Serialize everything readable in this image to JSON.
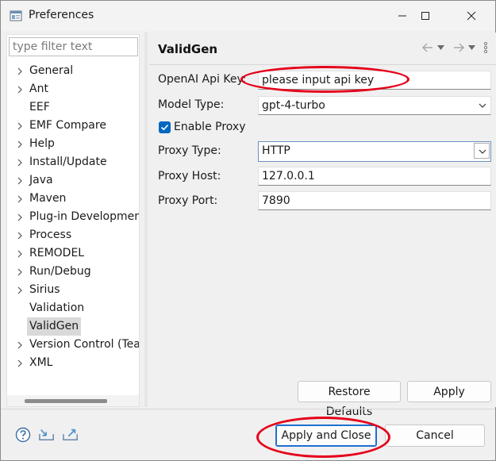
{
  "window": {
    "title": "Preferences"
  },
  "sidebar": {
    "filter_placeholder": "type filter text",
    "items": [
      {
        "label": "General",
        "expandable": true
      },
      {
        "label": "Ant",
        "expandable": true
      },
      {
        "label": "EEF",
        "expandable": false
      },
      {
        "label": "EMF Compare",
        "expandable": true
      },
      {
        "label": "Help",
        "expandable": true
      },
      {
        "label": "Install/Update",
        "expandable": true
      },
      {
        "label": "Java",
        "expandable": true
      },
      {
        "label": "Maven",
        "expandable": true
      },
      {
        "label": "Plug-in Development",
        "expandable": true
      },
      {
        "label": "Process",
        "expandable": true
      },
      {
        "label": "REMODEL",
        "expandable": true
      },
      {
        "label": "Run/Debug",
        "expandable": true
      },
      {
        "label": "Sirius",
        "expandable": true
      },
      {
        "label": "Validation",
        "expandable": false
      },
      {
        "label": "ValidGen",
        "expandable": false,
        "selected": true
      },
      {
        "label": "Version Control (Team)",
        "expandable": true
      },
      {
        "label": "XML",
        "expandable": true
      }
    ]
  },
  "page": {
    "title": "ValidGen",
    "fields": {
      "api_key_label": "OpenAI Api Key:",
      "api_key_value": "please input api key",
      "model_type_label": "Model Type:",
      "model_type_value": "gpt-4-turbo",
      "enable_proxy_label": "Enable Proxy",
      "enable_proxy_checked": true,
      "proxy_type_label": "Proxy Type:",
      "proxy_type_value": "HTTP",
      "proxy_host_label": "Proxy Host:",
      "proxy_host_value": "127.0.0.1",
      "proxy_port_label": "Proxy Port:",
      "proxy_port_value": "7890"
    },
    "buttons": {
      "restore_defaults": "Restore Defaults",
      "apply": "Apply"
    }
  },
  "footer": {
    "apply_and_close": "Apply and Close",
    "cancel": "Cancel"
  },
  "colors": {
    "highlight_ellipse": "#e5001a",
    "accent": "#0067c0"
  }
}
